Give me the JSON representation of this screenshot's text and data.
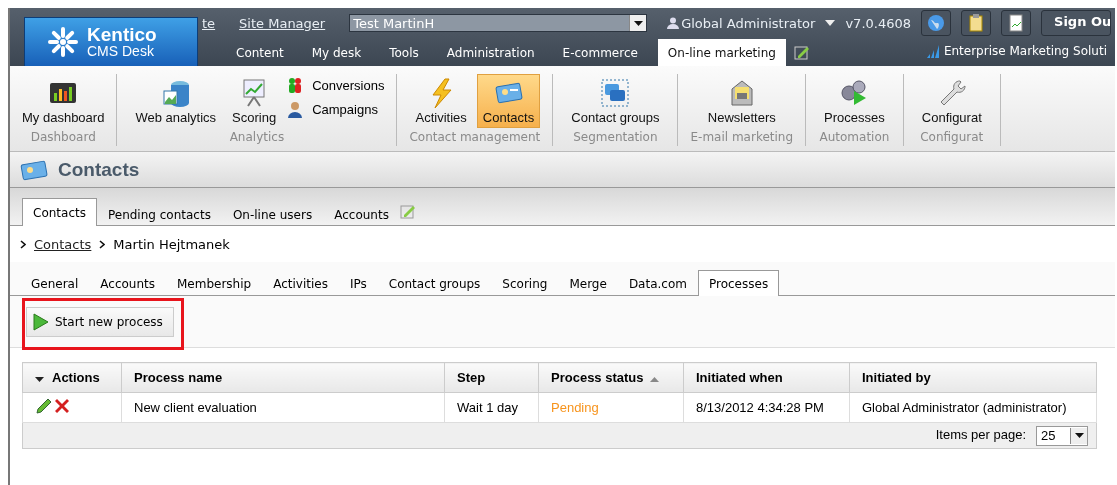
{
  "header": {
    "links": [
      "te",
      "Site Manager"
    ],
    "site_select": "Test MartinH",
    "user": "Global Administrator",
    "version": "v7.0.4608",
    "sign_out": "Sign Ou",
    "edition": "Enterprise Marketing Soluti",
    "logo": {
      "name": "Kentico",
      "subtitle": "CMS Desk"
    },
    "tabs": [
      {
        "label": "Content",
        "selected": false
      },
      {
        "label": "My desk",
        "selected": false
      },
      {
        "label": "Tools",
        "selected": false
      },
      {
        "label": "Administration",
        "selected": false
      },
      {
        "label": "E-commerce",
        "selected": false
      },
      {
        "label": "On-line marketing",
        "selected": true
      }
    ]
  },
  "ribbon": [
    {
      "label": "Dashboard",
      "items": [
        {
          "label": "My dashboard",
          "kind": "large",
          "selected": false
        }
      ]
    },
    {
      "label": "Analytics",
      "items": [
        {
          "label": "Web analytics",
          "kind": "large",
          "selected": false
        },
        {
          "label": "Scoring",
          "kind": "large",
          "selected": false
        },
        {
          "label": "Conversions",
          "kind": "small",
          "selected": false
        },
        {
          "label": "Campaigns",
          "kind": "small",
          "selected": false
        }
      ]
    },
    {
      "label": "Contact management",
      "items": [
        {
          "label": "Activities",
          "kind": "large",
          "selected": false
        },
        {
          "label": "Contacts",
          "kind": "large",
          "selected": true
        }
      ]
    },
    {
      "label": "Segmentation",
      "items": [
        {
          "label": "Contact groups",
          "kind": "large",
          "selected": false
        }
      ]
    },
    {
      "label": "E-mail marketing",
      "items": [
        {
          "label": "Newsletters",
          "kind": "large",
          "selected": false
        }
      ]
    },
    {
      "label": "Automation",
      "items": [
        {
          "label": "Processes",
          "kind": "large",
          "selected": false
        }
      ]
    },
    {
      "label": "Configurat",
      "items": [
        {
          "label": "Configurat",
          "kind": "large",
          "selected": false
        }
      ]
    }
  ],
  "page_title": "Contacts",
  "object_tabs": [
    {
      "label": "Contacts",
      "selected": true
    },
    {
      "label": "Pending contacts",
      "selected": false
    },
    {
      "label": "On-line users",
      "selected": false
    },
    {
      "label": "Accounts",
      "selected": false
    }
  ],
  "breadcrumb": {
    "link": "Contacts",
    "current": "Martin Hejtmanek"
  },
  "sub_tabs": [
    {
      "label": "General",
      "selected": false
    },
    {
      "label": "Accounts",
      "selected": false
    },
    {
      "label": "Membership",
      "selected": false
    },
    {
      "label": "Activities",
      "selected": false
    },
    {
      "label": "IPs",
      "selected": false
    },
    {
      "label": "Contact groups",
      "selected": false
    },
    {
      "label": "Scoring",
      "selected": false
    },
    {
      "label": "Merge",
      "selected": false
    },
    {
      "label": "Data.com",
      "selected": false
    },
    {
      "label": "Processes",
      "selected": true
    }
  ],
  "action_button": {
    "label": "Start new process",
    "highlighted": true
  },
  "table": {
    "columns": [
      {
        "label": "Actions",
        "has_menu": true,
        "sorted_ascending": false
      },
      {
        "label": "Process name",
        "has_menu": false,
        "sorted_ascending": false
      },
      {
        "label": "Step",
        "has_menu": false,
        "sorted_ascending": false
      },
      {
        "label": "Process status",
        "has_menu": false,
        "sorted_ascending": true
      },
      {
        "label": "Initiated when",
        "has_menu": false,
        "sorted_ascending": false
      },
      {
        "label": "Initiated by",
        "has_menu": false,
        "sorted_ascending": false
      }
    ],
    "rows": [
      {
        "process_name": "New client evaluation",
        "step": "Wait 1 day",
        "status": "Pending",
        "initiated_when": "8/13/2012 4:34:28 PM",
        "initiated_by": "Global Administrator (administrator)"
      }
    ],
    "pager": {
      "label": "Items per page:",
      "value": "25"
    }
  }
}
